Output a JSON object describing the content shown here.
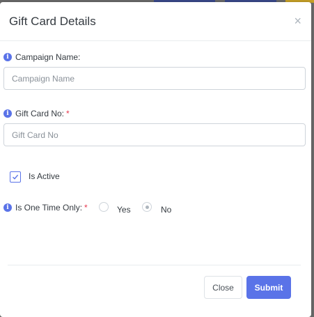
{
  "colors": {
    "accent": "#5a73e8",
    "required": "#e6374d",
    "backdrop": "#6b6b6b"
  },
  "modal": {
    "title": "Gift Card Details",
    "close_glyph": "×"
  },
  "form": {
    "campaign": {
      "label": "Campaign Name:",
      "placeholder": "Campaign Name",
      "value": ""
    },
    "gift_card_no": {
      "label": "Gift Card No:",
      "required_mark": "*",
      "placeholder": "Gift Card No",
      "value": ""
    },
    "is_active": {
      "label": "Is Active",
      "checked": true
    },
    "one_time": {
      "label": "Is One Time Only:",
      "required_mark": "*",
      "options": [
        {
          "label": "Yes",
          "selected": false
        },
        {
          "label": "No",
          "selected": true
        }
      ]
    }
  },
  "footer": {
    "close_label": "Close",
    "submit_label": "Submit"
  }
}
